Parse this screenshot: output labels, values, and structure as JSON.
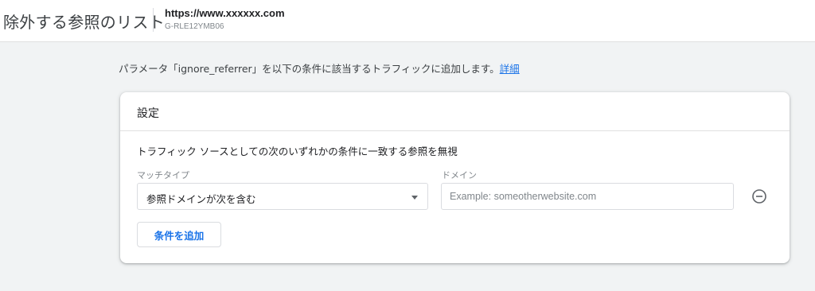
{
  "header": {
    "title": "除外する参照のリスト",
    "property_url": "https://www.xxxxxx.com",
    "property_id": "G-RLE12YMB06"
  },
  "description": {
    "text": "パラメータ「ignore_referrer」を以下の条件に該当するトラフィックに追加します。",
    "link_label": "詳細"
  },
  "card": {
    "title": "設定",
    "rule_text": "トラフィック ソースとしての次のいずれかの条件に一致する参照を無視",
    "match_type_label": "マッチタイプ",
    "match_type_value": "参照ドメインが次を含む",
    "domain_label": "ドメイン",
    "domain_placeholder": "Example: someotherwebsite.com",
    "domain_value": "",
    "add_condition_label": "条件を追加"
  },
  "icons": {
    "remove": "remove-circle-icon",
    "dropdown": "dropdown-arrow-icon"
  },
  "colors": {
    "accent": "#1a73e8",
    "background": "#f1f3f4"
  }
}
